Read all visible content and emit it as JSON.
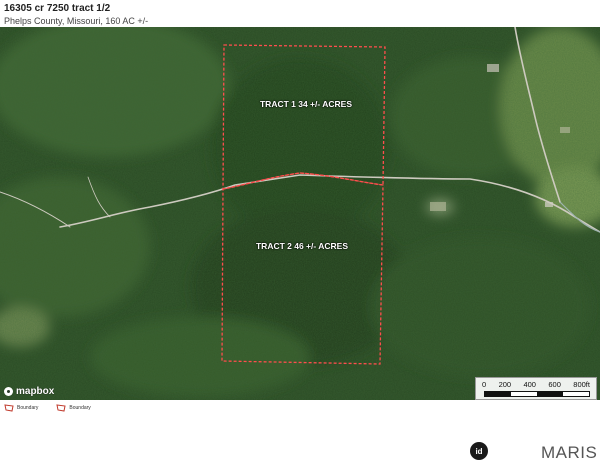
{
  "header": {
    "title": "16305 cr 7250 tract 1/2",
    "subtitle": "Phelps County, Missouri, 160 AC +/-"
  },
  "map": {
    "tracts": [
      {
        "label": "TRACT 1 34 +/- ACRES"
      },
      {
        "label": "TRACT 2 46 +/- ACRES"
      }
    ],
    "attribution": "mapbox",
    "scale": {
      "ticks": [
        "0",
        "200",
        "400",
        "600",
        "800ft"
      ]
    },
    "colors": {
      "boundary": "#ff3b3b",
      "forest_dark": "#1f3a1d",
      "forest_mid": "#2f5428",
      "pasture": "#6e8c4a",
      "road": "#c9c7bd"
    }
  },
  "legend": {
    "items": [
      {
        "label": "Boundary",
        "color": "#c0392b"
      },
      {
        "label": "Boundary",
        "color": "#c0392b"
      }
    ]
  },
  "footer": {
    "badge": "id",
    "brand": "MARIS"
  }
}
